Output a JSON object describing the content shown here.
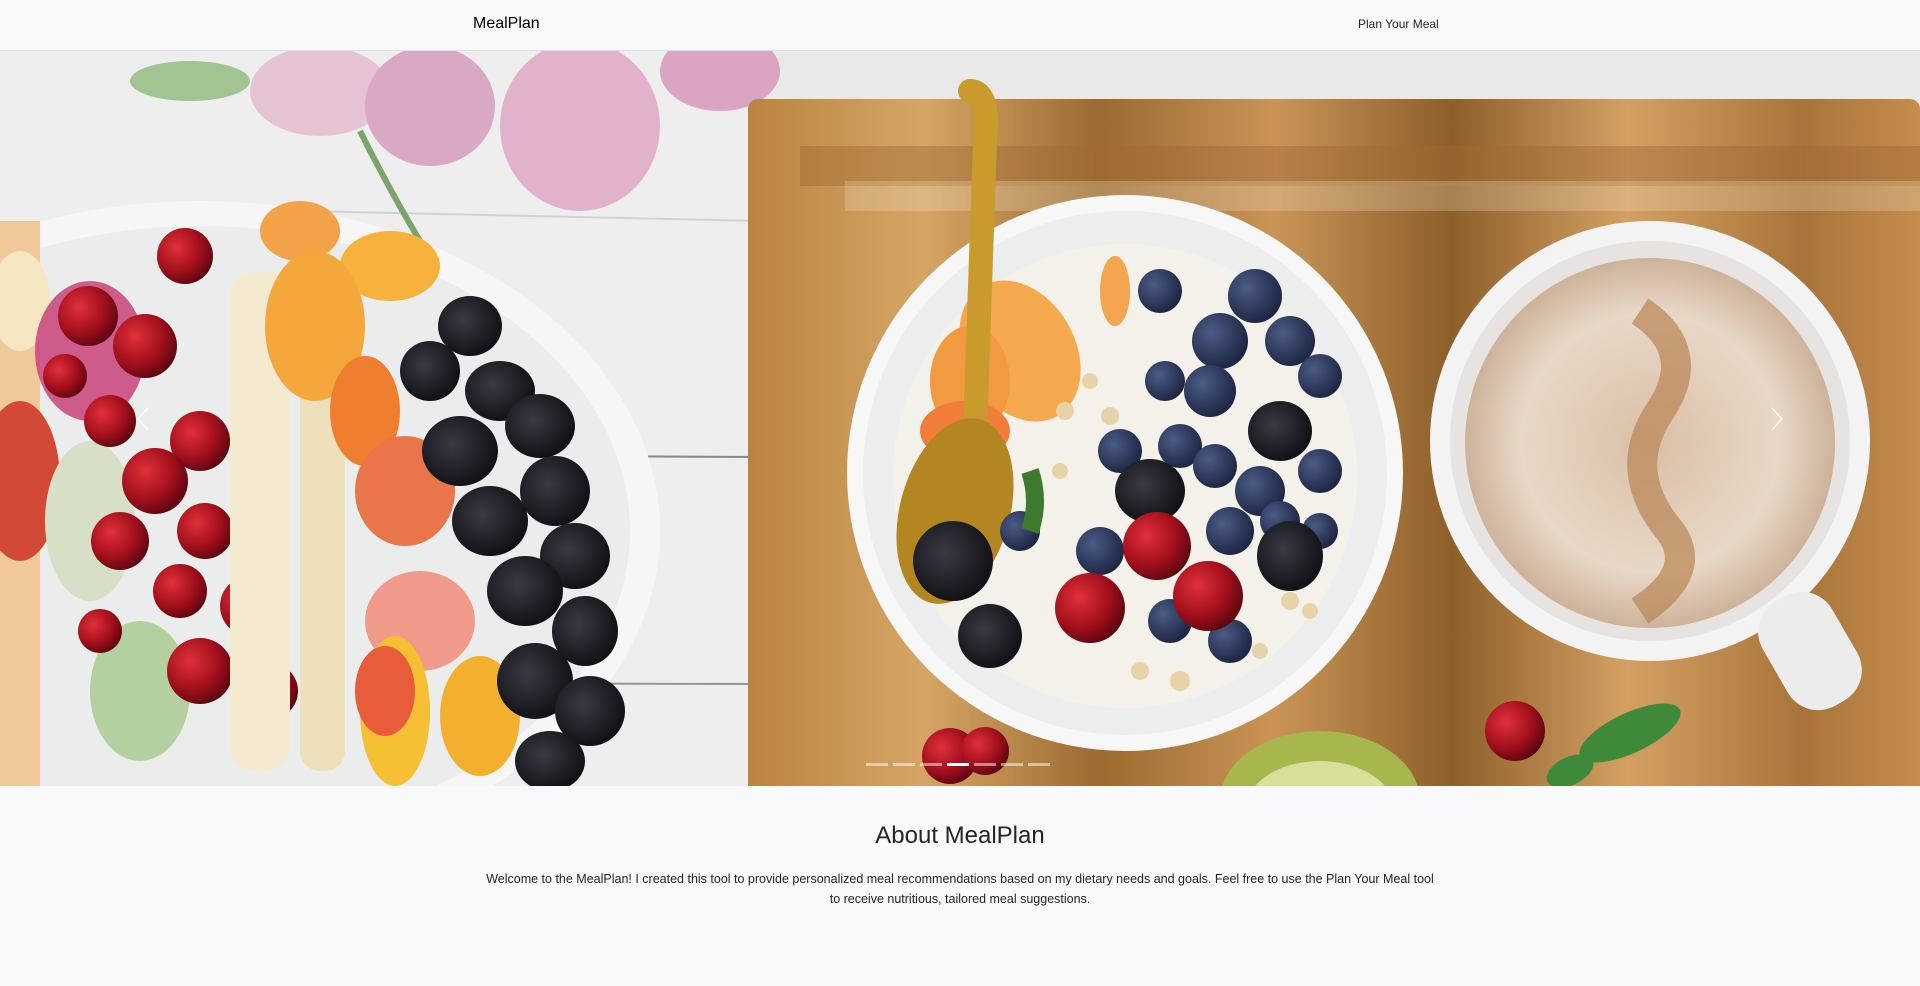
{
  "navbar": {
    "brand": "MealPlan",
    "links": [
      "Plan Your Meal"
    ]
  },
  "carousel": {
    "slide_count": 7,
    "active_index": 3,
    "prev_icon": "chevron-left-icon",
    "next_icon": "chevron-right-icon"
  },
  "about": {
    "title": "About MealPlan",
    "text": "Welcome to the MealPlan! I created this tool to provide personalized meal recommendations based on my dietary needs and goals. Feel free to use the Plan Your Meal tool to receive nutritious, tailored meal suggestions."
  },
  "colors": {
    "navbar_bg": "#f8f9fa",
    "page_bg": "#f8f9fa",
    "text": "#212529"
  }
}
